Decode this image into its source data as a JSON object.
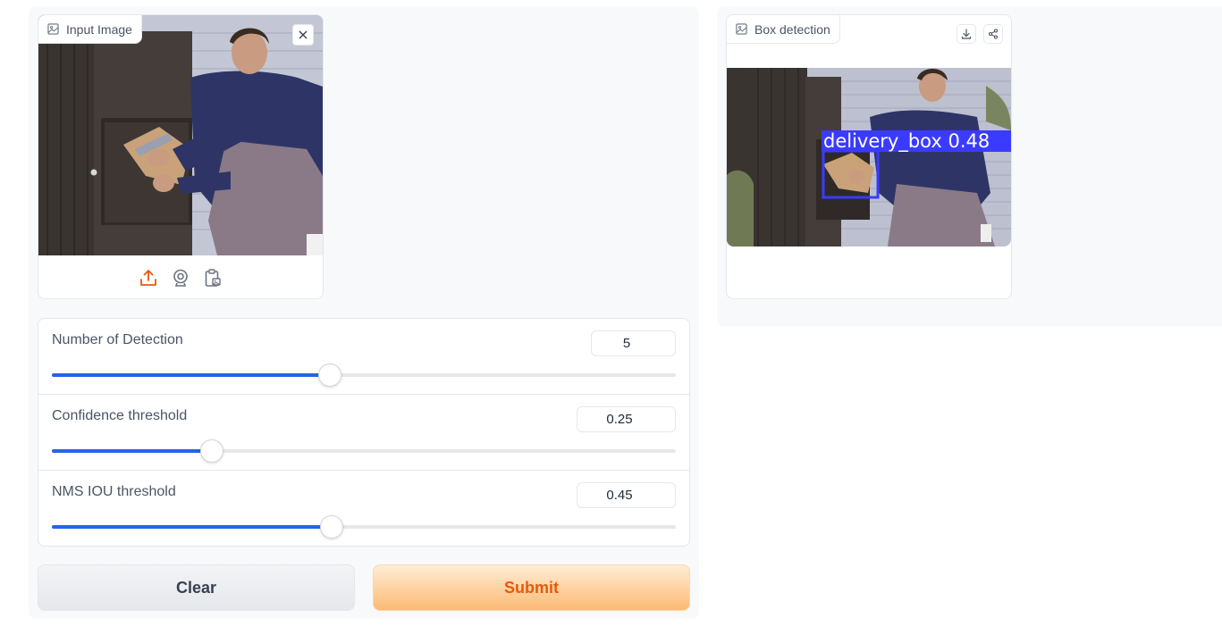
{
  "input_image": {
    "label": "Input Image",
    "icon": "image-icon"
  },
  "output_image": {
    "label": "Box detection",
    "icon": "image-icon",
    "detection_label": "delivery_box 0.48"
  },
  "sliders": [
    {
      "label": "Number of Detection",
      "value": "5",
      "fraction": 0.446
    },
    {
      "label": "Confidence threshold",
      "value": "0.25",
      "fraction": 0.257
    },
    {
      "label": "NMS IOU threshold",
      "value": "0.45",
      "fraction": 0.449
    }
  ],
  "buttons": {
    "clear": "Clear",
    "submit": "Submit"
  },
  "colors": {
    "accent": "#2563eb",
    "submit_text": "#ea580c",
    "upload_icon": "#ea580c",
    "detection_box": "#3b3bff"
  }
}
